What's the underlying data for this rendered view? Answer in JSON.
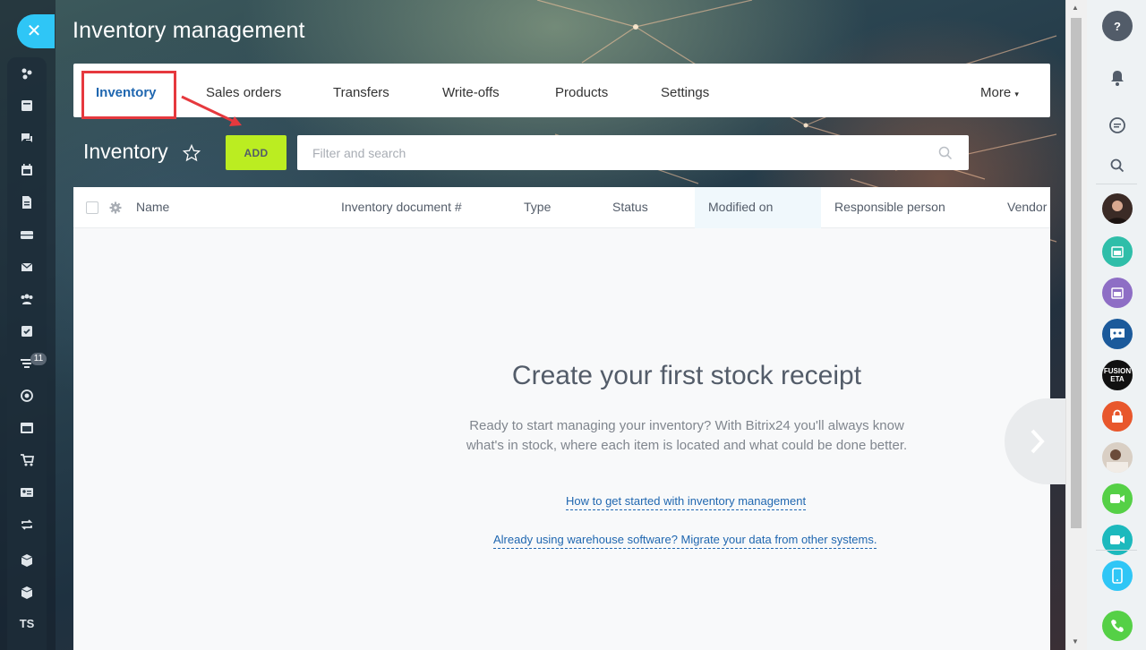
{
  "app": {
    "title": "Inventory management"
  },
  "tabs": [
    {
      "label": "Inventory",
      "active": true
    },
    {
      "label": "Sales orders"
    },
    {
      "label": "Transfers"
    },
    {
      "label": "Write-offs"
    },
    {
      "label": "Products"
    },
    {
      "label": "Settings"
    },
    {
      "label": "More"
    }
  ],
  "toolbar": {
    "title": "Inventory",
    "add_label": "ADD",
    "search_placeholder": "Filter and search"
  },
  "grid": {
    "columns": [
      "Name",
      "Inventory document #",
      "Type",
      "Status",
      "Modified on",
      "Responsible person",
      "Vendor"
    ],
    "sorted_column": "Modified on"
  },
  "empty_state": {
    "title": "Create your first stock receipt",
    "text": "Ready to start managing your inventory? With Bitrix24 you'll always know what's in stock, where each item is located and what could be done better.",
    "link1": "How to get started with inventory management",
    "link2": "Already using warehouse software? Migrate your data from other systems."
  },
  "left_menu": {
    "badge_count": "11",
    "user_initials": "TS",
    "icons": [
      "feed-icon",
      "tasks-icon",
      "chat-icon",
      "calendar-icon",
      "documents-icon",
      "drive-icon",
      "mail-icon",
      "groups-icon",
      "checklist-icon",
      "funnel-icon",
      "target-icon",
      "sites-icon",
      "cart-icon",
      "contact-card-icon",
      "sync-icon",
      "box-icon",
      "box-icon"
    ]
  },
  "right_bar": {
    "avatar_text": "FUSION ETA"
  },
  "colors": {
    "accent_blue": "#2fc6f6",
    "add_button": "#bbed21",
    "highlight_red": "#e6393e",
    "link_blue": "#2067b0"
  }
}
